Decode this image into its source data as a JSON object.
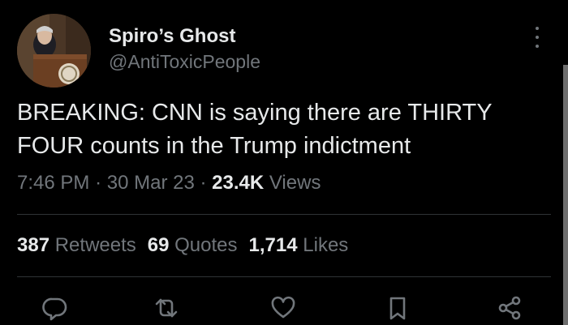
{
  "author": {
    "display_name": "Spiro’s Ghost",
    "handle": "@AntiToxicPeople"
  },
  "tweet": {
    "text": "BREAKING: CNN is saying there are THIRTY FOUR counts in the Trump indictment"
  },
  "meta": {
    "time": "7:46 PM",
    "separator": "·",
    "date": "30 Mar 23",
    "views_count": "23.4K",
    "views_label": "Views"
  },
  "stats": {
    "retweets_count": "387",
    "retweets_label": "Retweets",
    "quotes_count": "69",
    "quotes_label": "Quotes",
    "likes_count": "1,714",
    "likes_label": "Likes"
  },
  "icons": {
    "reply": "reply-icon",
    "retweet": "retweet-icon",
    "like": "like-icon",
    "bookmark": "bookmark-icon",
    "share": "share-icon",
    "more": "more-options-icon"
  },
  "colors": {
    "background": "#000000",
    "primary_text": "#e7e9ea",
    "secondary_text": "#71767b",
    "divider": "#2f3336"
  }
}
